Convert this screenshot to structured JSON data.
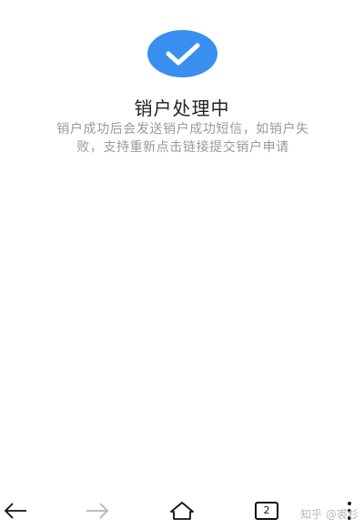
{
  "status": {
    "title": "销户处理中",
    "message": "销户成功后会发送销户成功短信，如销户失败，支持重新点击链接提交销户申请"
  },
  "nav": {
    "tab_count": "2"
  },
  "watermark": {
    "text": "知乎 @裘杉"
  },
  "colors": {
    "accent": "#3a8ef0",
    "title": "#222222",
    "message": "#9a9a9a"
  },
  "icons": {
    "status": "check-icon",
    "back": "arrow-left-icon",
    "forward": "arrow-right-icon",
    "home": "home-icon",
    "tabs": "tabs-icon",
    "menu": "more-vertical-icon"
  }
}
